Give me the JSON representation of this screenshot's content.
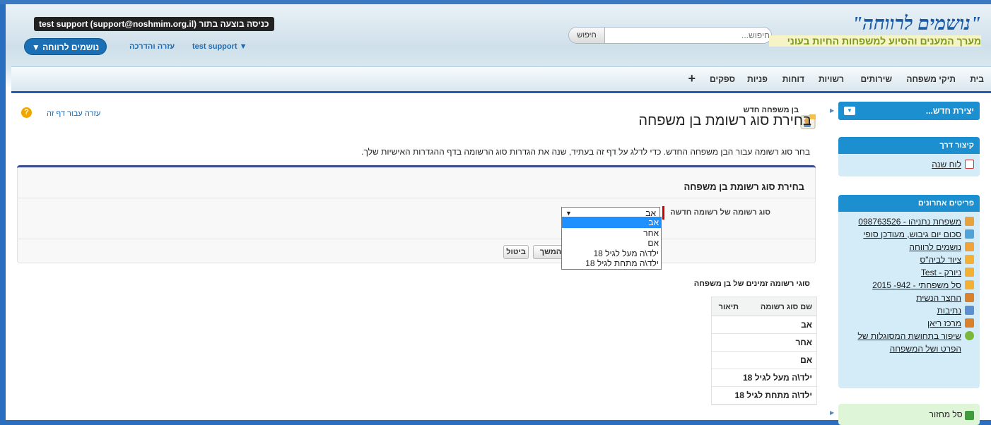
{
  "header": {
    "login_banner": "כניסה בוצעה בתור test support (support@noshmim.org.il)",
    "app_menu_label": "נושמים לרווחה ▼",
    "help_link": "עזרה והדרכה",
    "user_menu": "test support ▼",
    "search_placeholder": "חיפוש...",
    "search_button": "חיפוש",
    "logo_title": "\"נושמים לרווחה\"",
    "logo_subtitle": "מערך המענים והסיוע למשפחות החיות בעוני"
  },
  "tabs": [
    "בית",
    "תיקי משפחה",
    "שירותים",
    "רשויות",
    "דוחות",
    "פניות",
    "ספקים",
    "+"
  ],
  "sidebar": {
    "create_new": "יצירת חדש...",
    "shortcut_title": "קיצור דרך",
    "shortcut_items": [
      "לוח שנה"
    ],
    "recent_title": "פריטים אחרונים",
    "recent_items": [
      "משפחת נתניהו - 098763526",
      "סכום יום גיבוש, מעודכן סופי",
      "נושמים לרווחה",
      "ציוד לביה\"ס",
      "ניורק - Test",
      "סל משפחתי - 942- 2015",
      "החצר הנשית",
      "נתיבות",
      "מרכז ריאן",
      "שיפור בתחושת המסוגלות של הפרט ושל המשפחה"
    ],
    "recycle_bin": "סל מחזור"
  },
  "main": {
    "page_help": "עזרה עבור דף זה",
    "breadcrumb": "בן משפחה חדש",
    "title": "בחירת סוג רשומת בן משפחה",
    "intro": "בחר סוג רשומה עבור הבן משפחה החדש. כדי לדלג על דף זה בעתיד, שנה את הגדרות סוג הרשומה בדף ההגדרות האישיות שלך.",
    "block_title": "בחירת סוג רשומת בן משפחה",
    "field_label": "סוג רשומה של רשומה חדשה",
    "selected_value": "אב",
    "options": [
      "אב",
      "אחר",
      "אם",
      "ילד\\ה מעל לגיל 18",
      "ילד\\ה מתחת לגיל 18"
    ],
    "continue_button": "המשך",
    "cancel_button": "ביטול",
    "types_title": "סוגי רשומה זמינים של בן משפחה",
    "types_columns": [
      "שם סוג רשומה",
      "תיאור"
    ],
    "types_rows": [
      "אב",
      "אחר",
      "אם",
      "ילד\\ה מעל לגיל 18",
      "ילד\\ה מתחת לגיל 18"
    ]
  },
  "colors": {
    "accent": "#1b8fcf",
    "tab_underline": "#2a5ca8",
    "logo_blue": "#1a5ba8",
    "logo_green": "#7a9a17",
    "selection": "#1e90ff"
  }
}
